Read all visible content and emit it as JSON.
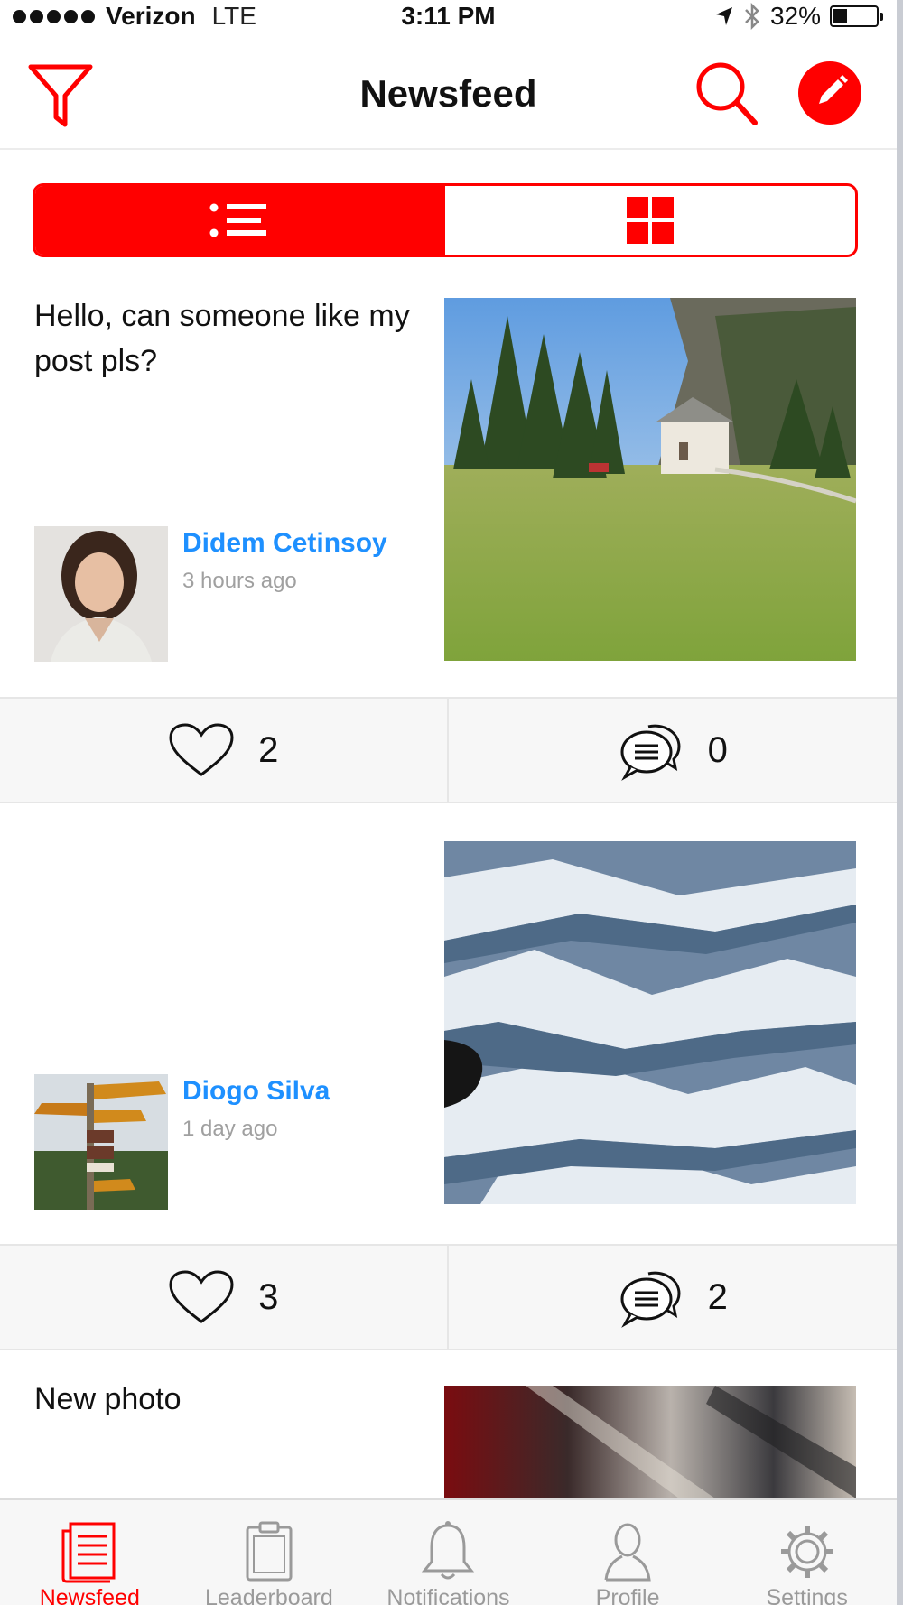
{
  "status_bar": {
    "carrier": "Verizon",
    "network": "LTE",
    "time": "3:11 PM",
    "battery": "32%",
    "battery_level": 0.32
  },
  "header": {
    "title": "Newsfeed",
    "accent_color": "#ff0000"
  },
  "view_toggle": {
    "options": [
      "list-view-icon",
      "grid-view-icon"
    ],
    "selected": "list-view-icon"
  },
  "posts": [
    {
      "text": "Hello, can someone like my post pls?",
      "author": "Didem Cetinsoy",
      "time": "3 hours ago",
      "likes": "2",
      "comments": "0"
    },
    {
      "text": "",
      "author": "Diogo Silva",
      "time": "1 day ago",
      "likes": "3",
      "comments": "2"
    },
    {
      "text": "New photo"
    }
  ],
  "tab_bar": {
    "items": [
      {
        "label": "Newsfeed",
        "icon": "newsfeed-icon"
      },
      {
        "label": "Leaderboard",
        "icon": "clipboard-icon"
      },
      {
        "label": "Notifications",
        "icon": "bell-icon"
      },
      {
        "label": "Profile",
        "icon": "person-icon"
      },
      {
        "label": "Settings",
        "icon": "gear-icon"
      }
    ],
    "active": "Newsfeed"
  },
  "colors": {
    "accent": "#ff0000",
    "author_link": "#1e90ff",
    "muted_text": "#a0a0a0"
  }
}
